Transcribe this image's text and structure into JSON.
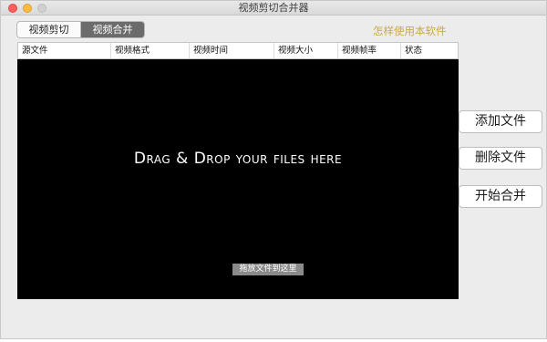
{
  "window": {
    "title": "视频剪切合并器"
  },
  "tabs": [
    {
      "label": "视频剪切",
      "active": false
    },
    {
      "label": "视频合并",
      "active": true
    }
  ],
  "help_link": "怎样使用本软件",
  "table": {
    "columns": [
      "源文件",
      "视频格式",
      "视频时间",
      "视频大小",
      "视频帧率",
      "状态"
    ],
    "rows": []
  },
  "drop_zone": {
    "title": "Drag & Drop your files here",
    "hint_button": "拖放文件到这里"
  },
  "actions": {
    "add": "添加文件",
    "delete": "删除文件",
    "start": "开始合并"
  },
  "colors": {
    "help_link": "#c9a84c",
    "active_tab": "#6b6b6b",
    "drop_background": "#000000"
  }
}
